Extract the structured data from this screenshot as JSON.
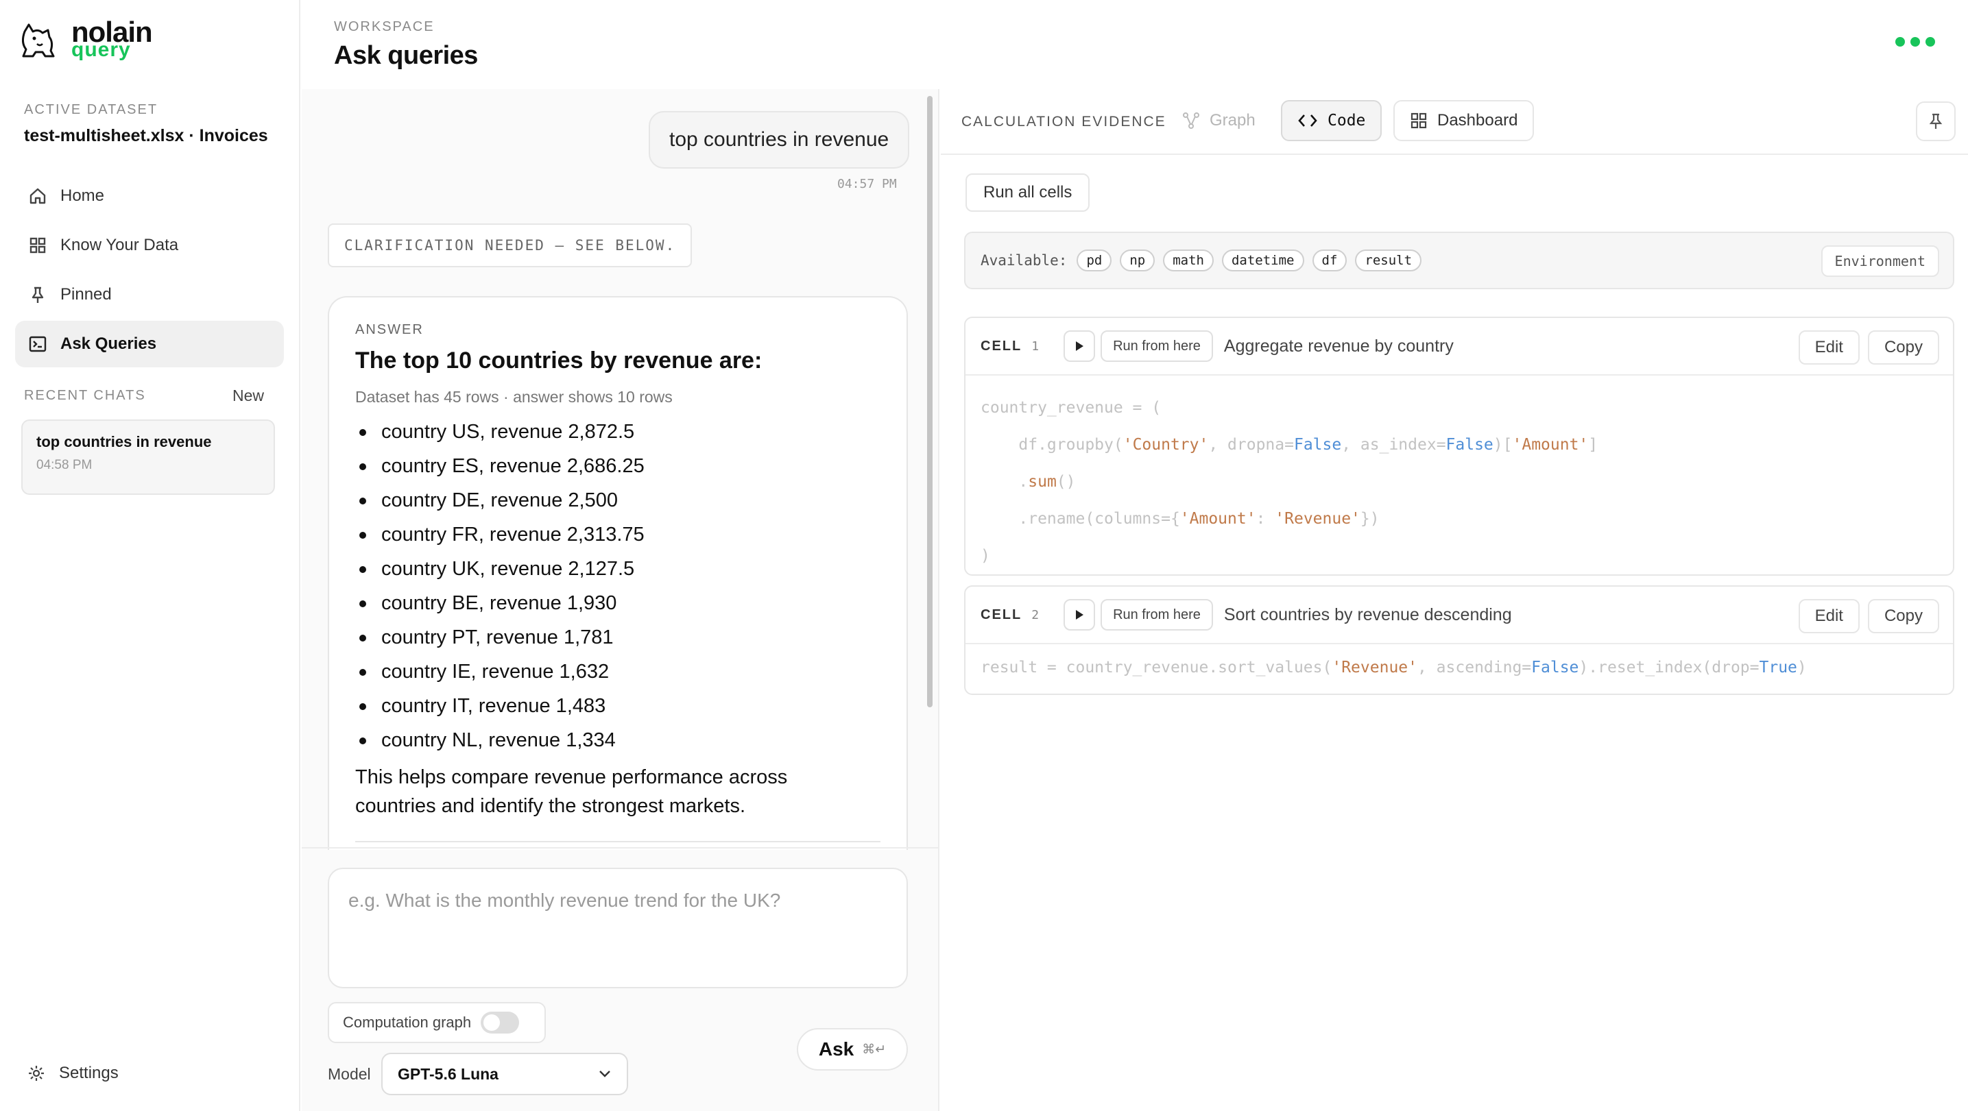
{
  "brand": {
    "name": "nolain",
    "sub": "query"
  },
  "sidebar": {
    "active_dataset_caption": "ACTIVE DATASET",
    "active_dataset_name": "test-multisheet.xlsx · Invoices",
    "nav": [
      {
        "label": "Home",
        "icon": "home-icon"
      },
      {
        "label": "Know Your Data",
        "icon": "grid-icon"
      },
      {
        "label": "Pinned",
        "icon": "pin-icon"
      },
      {
        "label": "Ask Queries",
        "icon": "terminal-icon",
        "active": true
      }
    ],
    "recent_caption": "RECENT CHATS",
    "recent_new": "New",
    "recent_chats": [
      {
        "title": "top countries in revenue",
        "time": "04:58 PM"
      }
    ],
    "settings_label": "Settings"
  },
  "header": {
    "caption": "WORKSPACE",
    "title": "Ask queries"
  },
  "chat": {
    "user_message": "top countries in revenue",
    "user_time": "04:57 PM",
    "clarification": "CLARIFICATION NEEDED — SEE BELOW.",
    "answer": {
      "caption": "ANSWER",
      "title": "The top 10 countries by revenue are:",
      "meta": "Dataset has 45 rows · answer shows 10 rows",
      "items": [
        "country US, revenue 2,872.5",
        "country ES, revenue 2,686.25",
        "country DE, revenue 2,500",
        "country FR, revenue 2,313.75",
        "country UK, revenue 2,127.5",
        "country BE, revenue 1,930",
        "country PT, revenue 1,781",
        "country IE, revenue 1,632",
        "country IT, revenue 1,483",
        "country NL, revenue 1,334"
      ],
      "footer": "This helps compare revenue performance across countries and identify the strongest markets."
    }
  },
  "composer": {
    "placeholder": "e.g. What is the monthly revenue trend for the UK?",
    "computation_graph_label": "Computation graph",
    "computation_graph_on": false,
    "model_label": "Model",
    "model_value": "GPT-5.6 Luna",
    "ask_label": "Ask",
    "ask_shortcut": "⌘↵"
  },
  "evidence": {
    "caption": "CALCULATION EVIDENCE",
    "tabs": [
      {
        "label": "Graph",
        "state": "disabled"
      },
      {
        "label": "Code",
        "state": "active"
      },
      {
        "label": "Dashboard",
        "state": "normal"
      }
    ],
    "run_all_label": "Run all cells",
    "env_label": "Available:",
    "env_chips": [
      "pd",
      "np",
      "math",
      "datetime",
      "df",
      "result"
    ],
    "env_button": "Environment",
    "cell_label": "CELL",
    "run_from_here": "Run from here",
    "edit_label": "Edit",
    "copy_label": "Copy",
    "cells": [
      {
        "num": "1",
        "desc": "Aggregate revenue by country",
        "code": [
          "country_revenue = (",
          "    df.groupby('Country', dropna=False, as_index=False)['Amount']",
          "    .sum()",
          "    .rename(columns={'Amount': 'Revenue'})",
          ")"
        ]
      },
      {
        "num": "2",
        "desc": "Sort countries by revenue descending",
        "code": [
          "result = country_revenue.sort_values('Revenue', ascending=False).reset_index(drop=True)"
        ]
      }
    ]
  },
  "colors": {
    "accent": "#18c45a",
    "string": "#c07a4a",
    "keyword": "#4f8ed6"
  }
}
